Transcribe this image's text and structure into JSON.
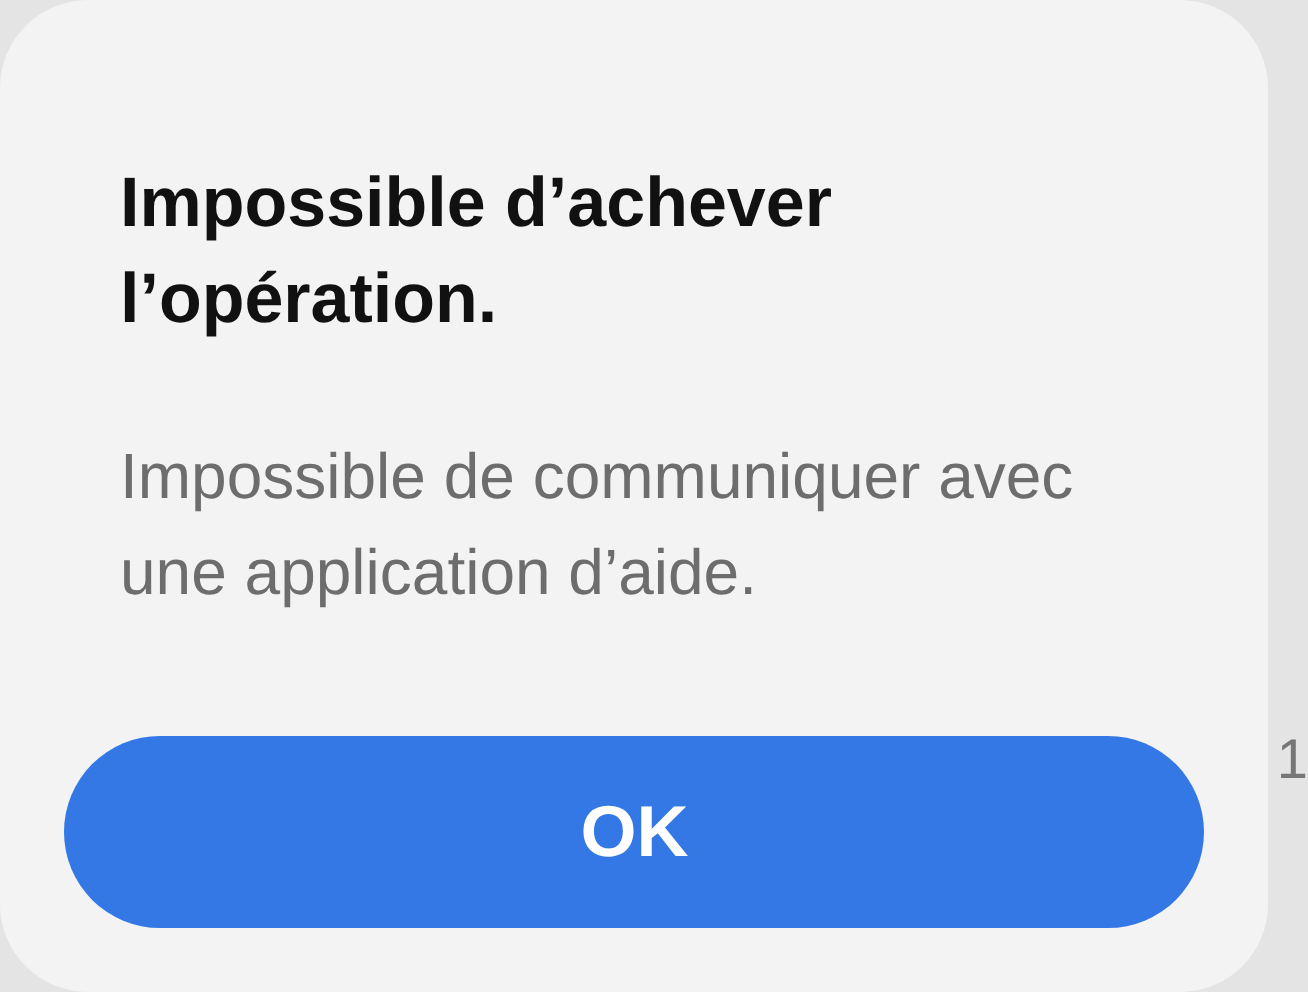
{
  "alert": {
    "title": "Impossible d’achever l’opération.",
    "message": "Impossible de communiquer avec une application d’aide.",
    "buttons": [
      "OK"
    ]
  },
  "background_text": "1"
}
